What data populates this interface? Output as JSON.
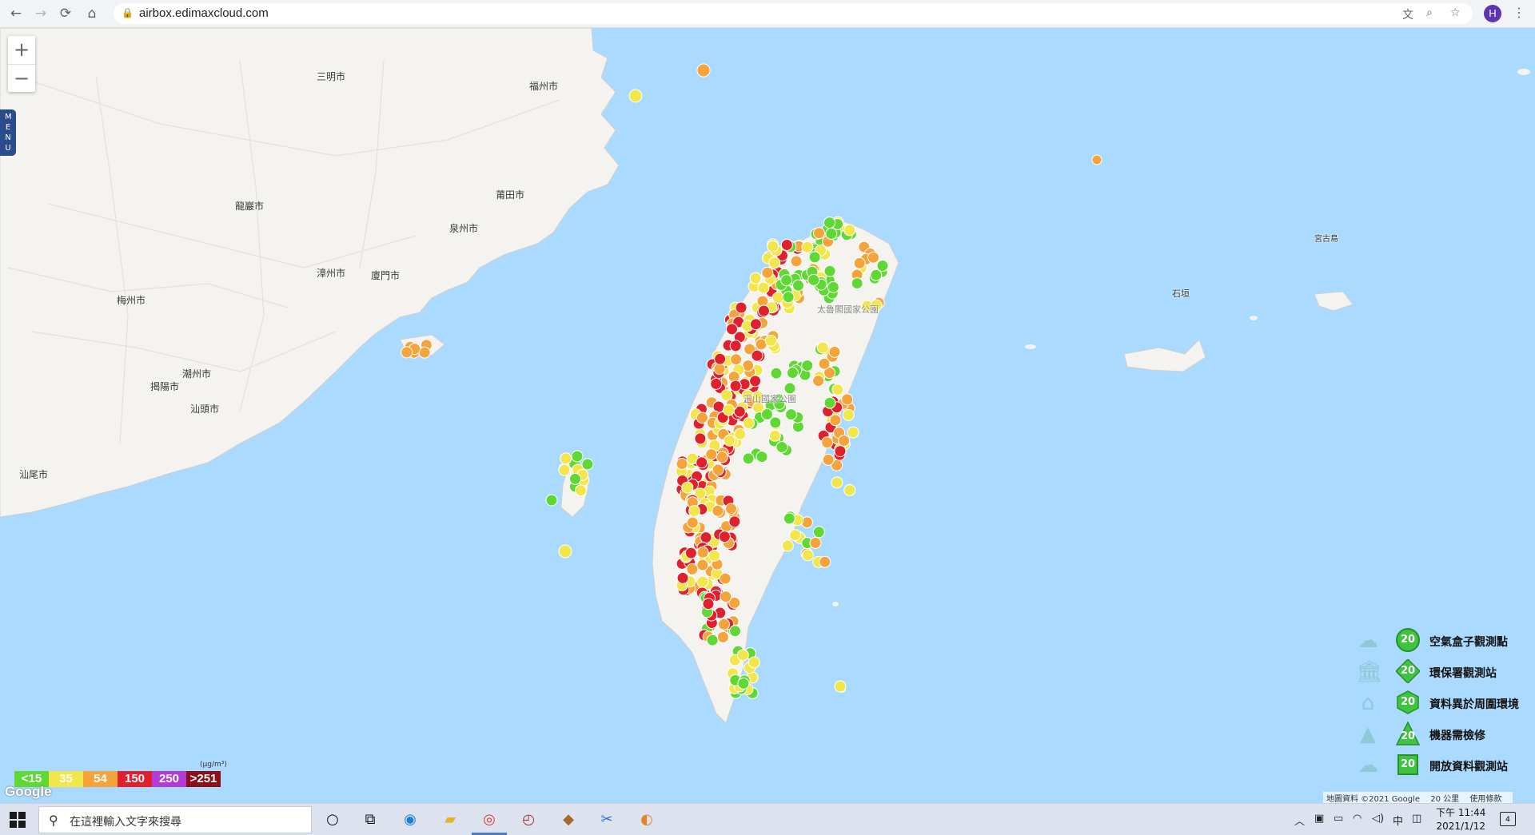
{
  "browser": {
    "url": "airbox.edimaxcloud.com",
    "profile_initial": "H"
  },
  "map": {
    "zoom_in": "+",
    "zoom_out": "−",
    "menu_tab": "MENU",
    "cities": [
      {
        "name": "三明市"
      },
      {
        "name": "福州市"
      },
      {
        "name": "莆田市"
      },
      {
        "name": "龍巖市"
      },
      {
        "name": "泉州市"
      },
      {
        "name": "漳州市"
      },
      {
        "name": "廈門市"
      },
      {
        "name": "梅州市"
      },
      {
        "name": "潮州市"
      },
      {
        "name": "揭陽市"
      },
      {
        "name": "汕頭市"
      },
      {
        "name": "汕尾市"
      },
      {
        "name": "宮古島"
      },
      {
        "name": "石垣"
      },
      {
        "name": "太魯閣國家公園"
      },
      {
        "name": "玉山國家公園"
      }
    ],
    "legend": [
      {
        "icon": "cloud-icon",
        "text": "空氣盒子觀測點",
        "badge": "20",
        "shape": "circle",
        "color": "#3ec43e"
      },
      {
        "icon": "government-building-icon",
        "text": "環保署觀測站",
        "badge": "20",
        "shape": "diamond",
        "color": "#3ec43e"
      },
      {
        "icon": "house-icon",
        "text": "資料異於周圍環境",
        "badge": "20",
        "shape": "hexagon",
        "color": "#3ec43e"
      },
      {
        "icon": "tower-icon",
        "text": "機器需檢修",
        "badge": "20",
        "shape": "triangle",
        "color": "#3ec43e"
      },
      {
        "icon": "cloud-stack-icon",
        "text": "開放資料觀測站",
        "badge": "20",
        "shape": "square",
        "color": "#3ec43e"
      }
    ],
    "scale_unit": "(μg/m³)",
    "scale": [
      {
        "label": "<15",
        "color": "#5fd834"
      },
      {
        "label": "35",
        "color": "#f2e64a"
      },
      {
        "label": "54",
        "color": "#f5a33b"
      },
      {
        "label": "150",
        "color": "#e0212d"
      },
      {
        "label": "250",
        "color": "#b33bd6"
      },
      {
        "label": ">251",
        "color": "#8b0f16"
      }
    ],
    "google_logo": "Google",
    "attribution": {
      "map_data": "地圖資料 ©2021 Google",
      "scale": "20 公里",
      "terms": "使用條款"
    }
  },
  "taskbar": {
    "search_placeholder": "在這裡輸入文字來搜尋",
    "ime": "中",
    "time": "下午 11:44",
    "date": "2021/1/12",
    "notifications": "4"
  }
}
